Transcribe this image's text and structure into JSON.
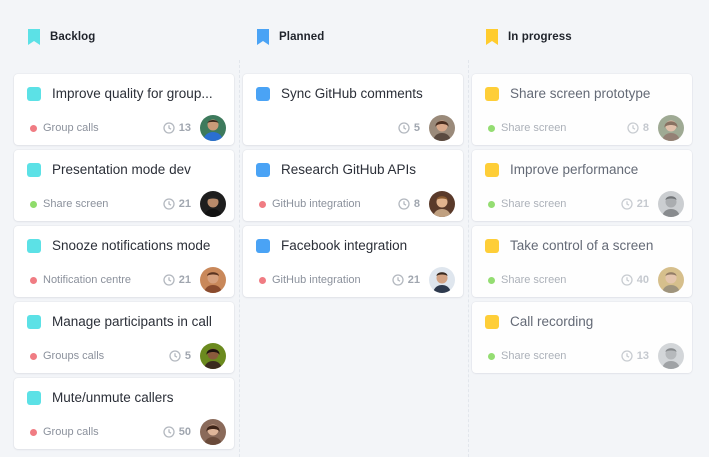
{
  "colors": {
    "teal": "#5ce1e6",
    "blue": "#4aa3f5",
    "yellow": "#ffcc2e",
    "red_dot": "#f07c83",
    "green_dot": "#8fdc6b"
  },
  "columns": [
    {
      "title": "Backlog",
      "icon": "bookmark-icon",
      "accent": "#5ce1e6",
      "cards": [
        {
          "title": "Improve quality for group...",
          "tag": "Group calls",
          "tag_color": "#f07c83",
          "count": "13",
          "avatar": "avatar-1"
        },
        {
          "title": "Presentation mode dev",
          "tag": "Share screen",
          "tag_color": "#8fdc6b",
          "count": "21",
          "avatar": "avatar-2"
        },
        {
          "title": "Snooze notifications mode",
          "tag": "Notification centre",
          "tag_color": "#f07c83",
          "count": "21",
          "avatar": "avatar-3"
        },
        {
          "title": "Manage participants in call",
          "tag": "Groups calls",
          "tag_color": "#f07c83",
          "count": "5",
          "avatar": "avatar-4"
        },
        {
          "title": "Mute/unmute callers",
          "tag": "Group calls",
          "tag_color": "#f07c83",
          "count": "50",
          "avatar": "avatar-5"
        }
      ]
    },
    {
      "title": "Planned",
      "icon": "bookmark-icon",
      "accent": "#4aa3f5",
      "cards": [
        {
          "title": "Sync GitHub comments",
          "tag": "",
          "tag_color": "",
          "count": "5",
          "avatar": "avatar-6"
        },
        {
          "title": "Research GitHub APIs",
          "tag": "GitHub integration",
          "tag_color": "#f07c83",
          "count": "8",
          "avatar": "avatar-7"
        },
        {
          "title": "Facebook integration",
          "tag": "GitHub integration",
          "tag_color": "#f07c83",
          "count": "21",
          "avatar": "avatar-8"
        }
      ]
    },
    {
      "title": "In progress",
      "icon": "bookmark-icon",
      "accent": "#ffcc2e",
      "cards": [
        {
          "title": "Share screen prototype",
          "tag": "Share screen",
          "tag_color": "#8fdc6b",
          "count": "8",
          "avatar": "avatar-9"
        },
        {
          "title": "Improve performance",
          "tag": "Share screen",
          "tag_color": "#8fdc6b",
          "count": "21",
          "avatar": "avatar-10"
        },
        {
          "title": "Take control of a screen",
          "tag": "Share screen",
          "tag_color": "#8fdc6b",
          "count": "40",
          "avatar": "avatar-11"
        },
        {
          "title": "Call recording",
          "tag": "Share screen",
          "tag_color": "#8fdc6b",
          "count": "13",
          "avatar": "avatar-12"
        }
      ]
    }
  ]
}
